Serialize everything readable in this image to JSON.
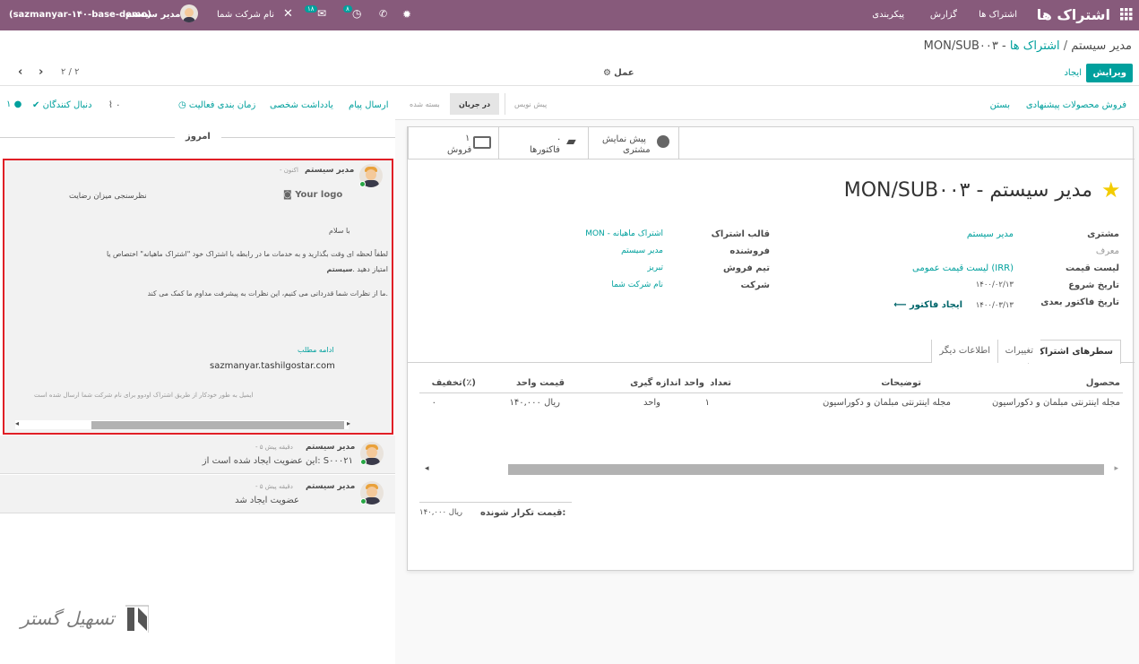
{
  "topbar": {
    "app_title": "اشتراک ها",
    "menu": [
      "اشتراک ها",
      "گزارش",
      "پیکربندی"
    ],
    "db_name": "(sazmanyar-۱۴۰-base-demo)",
    "user_name": "مدیر سیستم",
    "company_name": "نام شرکت شما",
    "messages_count": "۱۸",
    "activities_count": "۸",
    "brand_color": "#875a7b"
  },
  "breadcrumb": {
    "parent": "اشتراک ها",
    "separator": "/",
    "current": "MON/SUB۰۰۳ - مدیر سیستم"
  },
  "actions": {
    "edit_label": "ویرایش",
    "create_label": "ایجاد",
    "action_label": "عمل",
    "pager_value": "۲ / ۲"
  },
  "header_buttons": {
    "sell_products_label": "فروش محصولات پیشنهادی",
    "close_label": "بستن"
  },
  "statusbar": [
    "پیش نویس",
    "در جریان",
    "بسته شده"
  ],
  "statusbar_active": "در جریان",
  "smart_buttons": {
    "preview_label_1": "پیش نمایش",
    "preview_label_2": "مشتری",
    "invoices_count": "۰",
    "invoices_label": "فاکتورها",
    "sales_count": "۱",
    "sales_label": "فروش"
  },
  "record": {
    "title": "MON/SUB۰۰۳ - مدیر سیستم",
    "customer_label": "مشتری",
    "customer_value": "مدیر سیستم",
    "referrer_label": "معرف",
    "pricelist_label": "لیست قیمت",
    "pricelist_value": "لیست قیمت عمومی (IRR)",
    "start_date_label": "تاریخ شروع",
    "start_date_value": "۱۴۰۰/۰۲/۱۳",
    "next_invoice_label": "تاریخ فاکتور بعدی",
    "next_invoice_value": "۱۴۰۰/۰۳/۱۳",
    "create_invoice_label": "ایجاد فاکتور",
    "template_label": "قالب اشتراک",
    "template_value": "MON - اشتراک ماهیانه",
    "salesperson_label": "فروشنده",
    "salesperson_value": "مدیر سیستم",
    "sales_team_label": "تیم فروش",
    "sales_team_value": "تبریز",
    "company_label": "شرکت",
    "company_value": "نام شرکت شما"
  },
  "tabs": [
    "سطرهای اشتراک",
    "تغییرات",
    "اطلاعات دیگر"
  ],
  "table": {
    "headers": [
      "محصول",
      "توضیحات",
      "تعداد",
      "واحد اندازه گیری",
      "قیمت واحد",
      "تخفیف(٪)"
    ],
    "rows": [
      [
        "مجله اینترنتی مبلمان و دکوراسیون",
        "مجله اینترنتی مبلمان و دکوراسیون",
        "۱",
        "واحد",
        "۱۴۰,۰۰۰ ریال",
        "۰"
      ]
    ],
    "recurring_label": "قیمت تکرار شونده:",
    "recurring_value": "۱۴۰,۰۰۰ ریال"
  },
  "chatter": {
    "send_message": "ارسال پیام",
    "log_note": "یادداشت شخصی",
    "schedule_activity": "زمان بندی فعالیت",
    "attachments_count": "۰",
    "follow_label": "دنبال کنندگان",
    "followers_count": "۱",
    "today_label": "امروز",
    "messages": [
      {
        "author": "مدیر سیستم",
        "time": "- اکنون",
        "logo": "Your logo",
        "survey_title": "نظرسنجی میزان رضایت",
        "greeting": "با سلام",
        "line1": "لطفاً لحظه ای وقت بگذارید و به خدمات ما در رابطه با اشتراک خود \"اشتراک ماهیانه\" اختصاص یا",
        "line2": "سیستم",
        "line2b": "امتیاز دهید .",
        "line3": "ما از نظرات شما قدردانی می کنیم، این نظرات به پیشرفت مداوم ما کمک می کند.",
        "continue_label": "ادامه مطلب",
        "site": "sazmanyar.tashilgostar.com",
        "footer": "ایمیل به طور خودکار از طریق اشتراک اودوو برای نام شرکت شما ارسال شده است"
      },
      {
        "author": "مدیر سیستم",
        "time": "- ۵ دقیقه پیش",
        "body": "این عضویت ایجاد شده است از: S۰۰۰۲۱"
      },
      {
        "author": "مدیر سیستم",
        "time": "- ۵ دقیقه پیش",
        "body": "عضویت ایجاد شد"
      }
    ]
  },
  "watermark": "تسهیل گستر"
}
